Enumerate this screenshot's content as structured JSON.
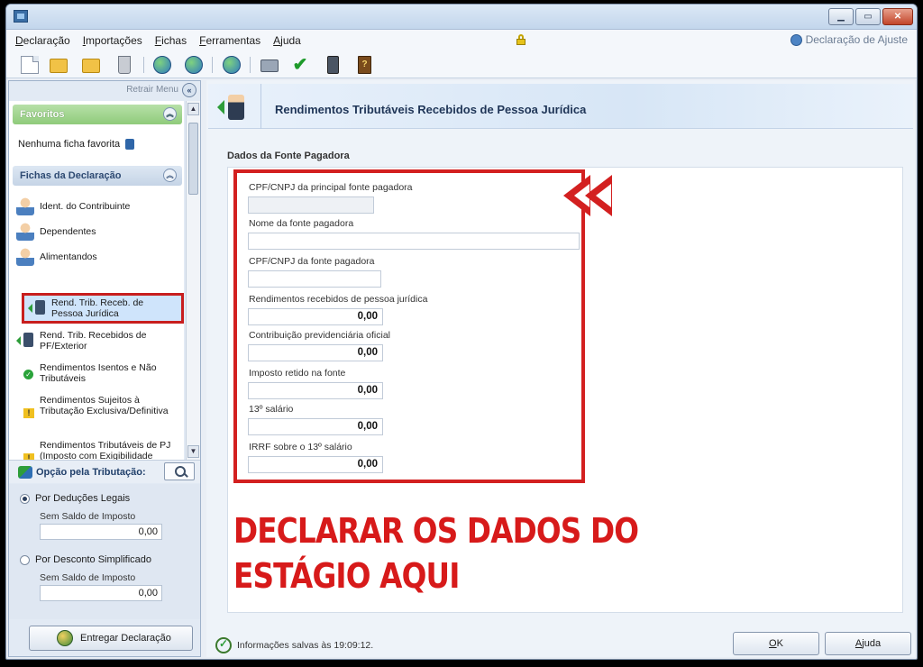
{
  "menu": [
    "Declaração",
    "Importações",
    "Fichas",
    "Ferramentas",
    "Ajuda"
  ],
  "declaration_type": "Declaração de Ajuste",
  "left": {
    "retrair": "Retrair Menu",
    "favoritos": "Favoritos",
    "no_favorites": "Nenhuma ficha favorita",
    "fichas_title": "Fichas da Declaração",
    "items": [
      "Ident. do Contribuinte",
      "Dependentes",
      "Alimentandos",
      "Rend. Trib. Receb. de Pessoa Jurídica",
      "Rend. Trib. Recebidos de PF/Exterior",
      "Rendimentos Isentos e Não Tributáveis",
      "Rendimentos Sujeitos à Tributação Exclusiva/Definitiva",
      "Rendimentos Tributáveis de PJ (Imposto com Exigibilidade Suspensa)"
    ],
    "opcao": "Opção pela Tributação:",
    "deducoes": "Por Deduções Legais",
    "desconto": "Por Desconto Simplificado",
    "saldo_label": "Sem Saldo de Imposto",
    "saldo_deducoes": "0,00",
    "saldo_desconto": "0,00",
    "entregar": "Entregar Declaração"
  },
  "main": {
    "header_title": "Rendimentos Tributáveis Recebidos de Pessoa Jurídica",
    "section_title": "Dados da Fonte Pagadora",
    "fields": {
      "cpf_principal": "CPF/CNPJ da principal fonte pagadora",
      "nome": "Nome da fonte pagadora",
      "cpf_fonte": "CPF/CNPJ da fonte pagadora",
      "rendimentos": "Rendimentos recebidos de pessoa jurídica",
      "rendimentos_val": "0,00",
      "contribuicao": "Contribuição previdenciária oficial",
      "contribuicao_val": "0,00",
      "imposto": "Imposto retido na fonte",
      "imposto_val": "0,00",
      "decimo": "13º salário",
      "decimo_val": "0,00",
      "irrf": "IRRF sobre o 13º salário",
      "irrf_val": "0,00"
    },
    "annotation_line1": "DECLARAR OS DADOS DO",
    "annotation_line2": "ESTÁGIO AQUI",
    "status": "Informações salvas às 19:09:12.",
    "ok": "OK",
    "ajuda": "Ajuda"
  }
}
